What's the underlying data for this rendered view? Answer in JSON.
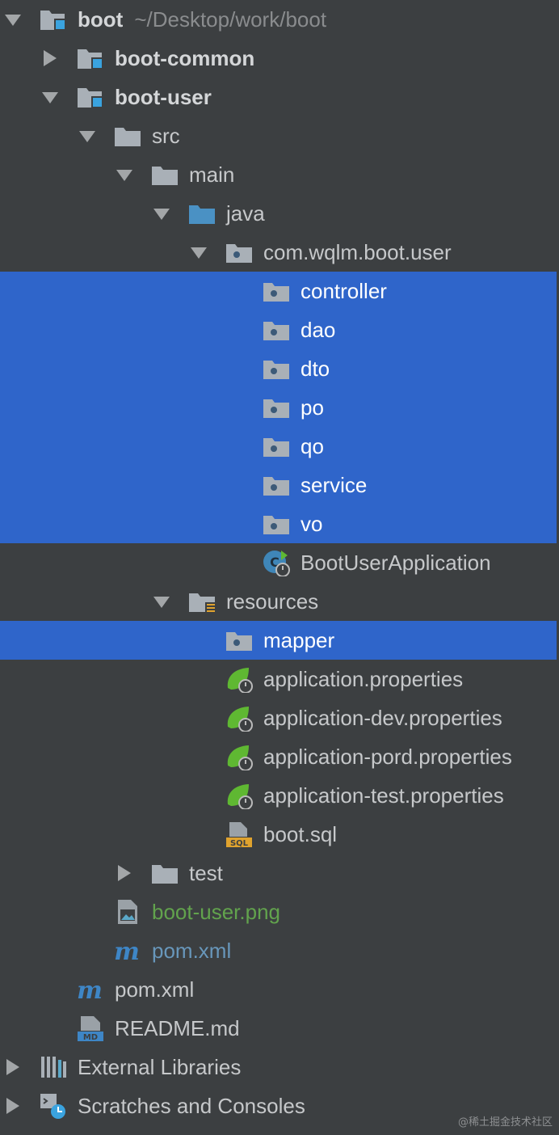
{
  "tree": [
    {
      "label": "boot",
      "hint": "~/Desktop/work/boot",
      "depth": 0,
      "arrow": "down",
      "icon": "module-folder-icon",
      "style": "bold"
    },
    {
      "label": "boot-common",
      "depth": 1,
      "arrow": "right",
      "icon": "module-folder-icon",
      "style": "bold"
    },
    {
      "label": "boot-user",
      "depth": 1,
      "arrow": "down",
      "icon": "module-folder-icon",
      "style": "bold"
    },
    {
      "label": "src",
      "depth": 2,
      "arrow": "down",
      "icon": "folder-icon"
    },
    {
      "label": "main",
      "depth": 3,
      "arrow": "down",
      "icon": "folder-icon"
    },
    {
      "label": "java",
      "depth": 4,
      "arrow": "down",
      "icon": "source-folder-icon"
    },
    {
      "label": "com.wqlm.boot.user",
      "depth": 5,
      "arrow": "down",
      "icon": "package-icon"
    },
    {
      "label": "controller",
      "depth": 6,
      "icon": "package-icon",
      "selected": true
    },
    {
      "label": "dao",
      "depth": 6,
      "icon": "package-icon",
      "selected": true
    },
    {
      "label": "dto",
      "depth": 6,
      "icon": "package-icon",
      "selected": true
    },
    {
      "label": "po",
      "depth": 6,
      "icon": "package-icon",
      "selected": true
    },
    {
      "label": "qo",
      "depth": 6,
      "icon": "package-icon",
      "selected": true
    },
    {
      "label": "service",
      "depth": 6,
      "icon": "package-icon",
      "selected": true
    },
    {
      "label": "vo",
      "depth": 6,
      "icon": "package-icon",
      "selected": true
    },
    {
      "label": "BootUserApplication",
      "depth": 6,
      "icon": "spring-boot-class-icon"
    },
    {
      "label": "resources",
      "depth": 4,
      "arrow": "down",
      "icon": "resources-folder-icon"
    },
    {
      "label": "mapper",
      "depth": 5,
      "icon": "package-icon",
      "selected": true
    },
    {
      "label": "application.properties",
      "depth": 5,
      "icon": "spring-properties-icon"
    },
    {
      "label": "application-dev.properties",
      "depth": 5,
      "icon": "spring-properties-icon"
    },
    {
      "label": "application-pord.properties",
      "depth": 5,
      "icon": "spring-properties-icon"
    },
    {
      "label": "application-test.properties",
      "depth": 5,
      "icon": "spring-properties-icon"
    },
    {
      "label": "boot.sql",
      "depth": 5,
      "icon": "sql-file-icon"
    },
    {
      "label": "test",
      "depth": 3,
      "arrow": "right",
      "icon": "folder-icon"
    },
    {
      "label": "boot-user.png",
      "depth": 2,
      "icon": "image-file-icon",
      "style": "green"
    },
    {
      "label": "pom.xml",
      "depth": 2,
      "icon": "maven-icon",
      "style": "blue"
    },
    {
      "label": "pom.xml",
      "depth": 1,
      "icon": "maven-icon"
    },
    {
      "label": "README.md",
      "depth": 1,
      "icon": "markdown-file-icon"
    },
    {
      "label": "External Libraries",
      "depth": 0,
      "arrow": "right",
      "icon": "libraries-icon"
    },
    {
      "label": "Scratches and Consoles",
      "depth": 0,
      "arrow": "right",
      "icon": "scratches-icon"
    }
  ],
  "watermark": "@稀土掘金技术社区",
  "colors": {
    "background": "#3c3f41",
    "selection": "#2f65ca",
    "folder": "#a9b0b7",
    "source_folder": "#4a91c4",
    "spring_green": "#5fb832",
    "module_badge": "#3aa3df"
  }
}
